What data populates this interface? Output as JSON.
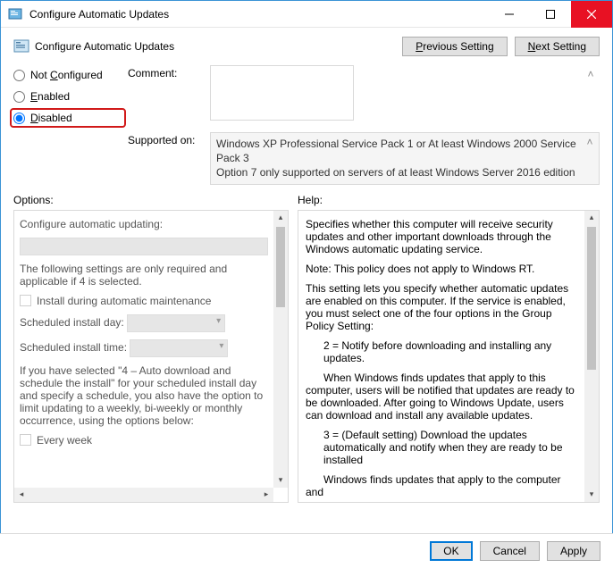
{
  "window": {
    "title": "Configure Automatic Updates"
  },
  "header": {
    "title": "Configure Automatic Updates",
    "previous_btn": "Previous Setting",
    "next_btn": "Next Setting"
  },
  "state": {
    "not_configured": "Not Configured",
    "enabled": "Enabled",
    "disabled": "Disabled",
    "selected": "disabled"
  },
  "comment": {
    "label": "Comment:",
    "value": ""
  },
  "supported": {
    "label": "Supported on:",
    "text": "Windows XP Professional Service Pack 1 or At least Windows 2000 Service Pack 3\nOption 7 only supported on servers of at least Windows Server 2016 edition"
  },
  "options": {
    "header": "Options:",
    "configure_label": "Configure automatic updating:",
    "note": "The following settings are only required and applicable if 4 is selected.",
    "install_maintenance": "Install during automatic maintenance",
    "install_day_label": "Scheduled install day:",
    "install_time_label": "Scheduled install time:",
    "scheduled_note": "If you have selected \"4 – Auto download and schedule the install\" for your scheduled install day and specify a schedule, you also have the option to limit updating to a weekly, bi-weekly or monthly occurrence, using the options below:",
    "every_week": "Every week"
  },
  "help": {
    "header": "Help:",
    "p1": "Specifies whether this computer will receive security updates and other important downloads through the Windows automatic updating service.",
    "p2": "Note: This policy does not apply to Windows RT.",
    "p3": "This setting lets you specify whether automatic updates are enabled on this computer. If the service is enabled, you must select one of the four options in the Group Policy Setting:",
    "p4": "2 = Notify before downloading and installing any updates.",
    "p5": "When Windows finds updates that apply to this computer, users will be notified that updates are ready to be downloaded. After going to Windows Update, users can download and install any available updates.",
    "p6": "3 = (Default setting) Download the updates automatically and notify when they are ready to be installed",
    "p7": "Windows finds updates that apply to the computer and"
  },
  "footer": {
    "ok": "OK",
    "cancel": "Cancel",
    "apply": "Apply"
  }
}
